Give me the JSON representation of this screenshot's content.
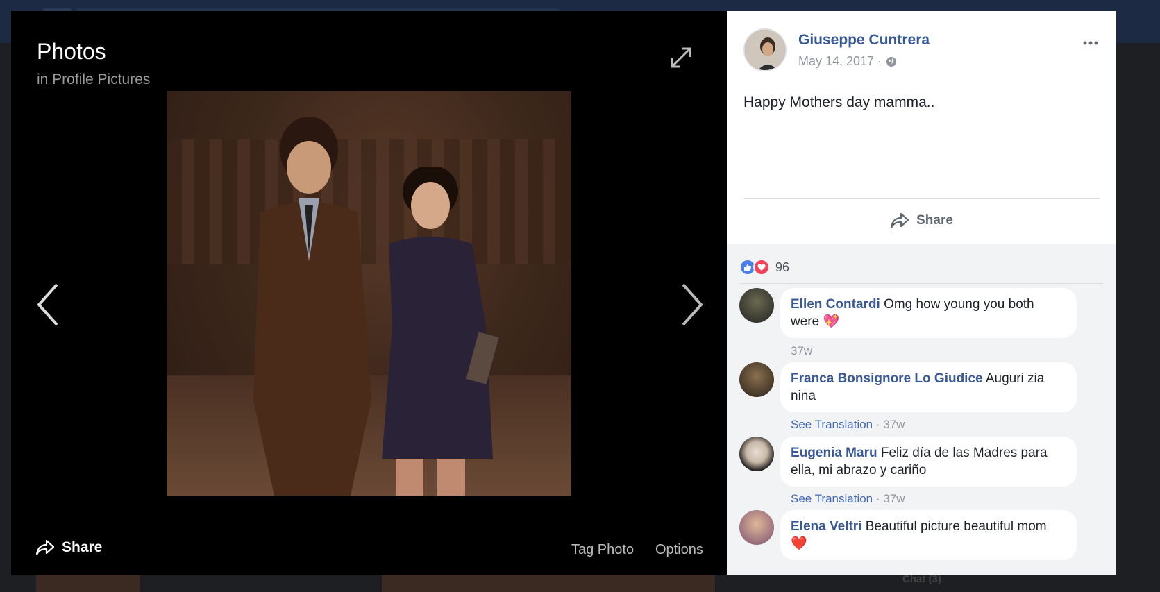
{
  "viewer": {
    "title": "Photos",
    "subtitle": "in Profile Pictures",
    "share_label": "Share",
    "tag_photo_label": "Tag Photo",
    "options_label": "Options"
  },
  "post": {
    "author": "Giuseppe Cuntrera",
    "date": "May 14, 2017 ·",
    "text": "Happy Mothers day mamma..",
    "share_label": "Share"
  },
  "reactions": {
    "count": "96"
  },
  "comments": [
    {
      "name": "Ellen Contardi",
      "text": "Omg how young you both were",
      "emoji": "💖",
      "see_translation": "",
      "time": "37w"
    },
    {
      "name": "Franca Bonsignore Lo Giudice",
      "text": "Auguri zia nina",
      "see_translation": "See Translation",
      "time": "· 37w"
    },
    {
      "name": "Eugenia Maru",
      "text": "Feliz día de las Madres para ella, mi abrazo y cariño",
      "see_translation": "See Translation",
      "time": "· 37w"
    },
    {
      "name": "Elena Veltri",
      "text": "Beautiful picture beautiful mom",
      "emoji": "❤️"
    }
  ],
  "background": {
    "chat_label": "Chat (3)"
  },
  "colors": {
    "link_blue": "#365899",
    "like_blue": "#4a7eea",
    "love_red": "#f0425a"
  }
}
